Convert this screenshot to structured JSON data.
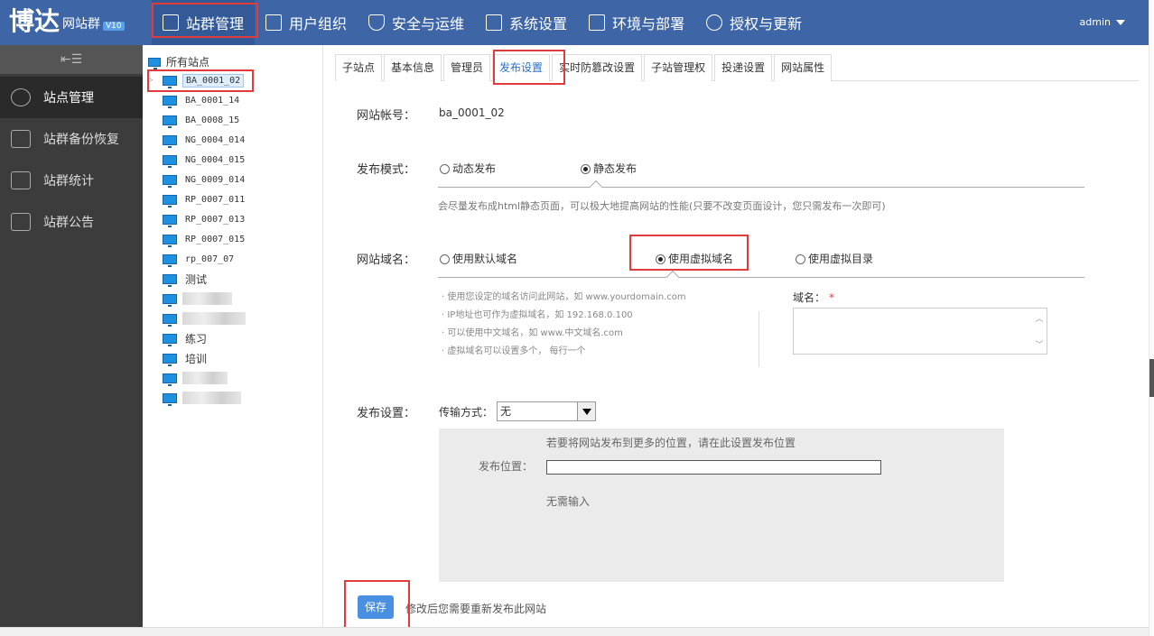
{
  "header": {
    "logo_main": "博达",
    "logo_sub": "网站群",
    "logo_version": "V10",
    "nav": [
      {
        "label": "站群管理",
        "icon": "site-manage-icon"
      },
      {
        "label": "用户组织",
        "icon": "user-org-icon"
      },
      {
        "label": "安全与运维",
        "icon": "shield-icon"
      },
      {
        "label": "系统设置",
        "icon": "settings-icon"
      },
      {
        "label": "环境与部署",
        "icon": "deploy-icon"
      },
      {
        "label": "授权与更新",
        "icon": "license-icon"
      }
    ],
    "user": "admin"
  },
  "sidebar": {
    "toggle": "⇤☰",
    "items": [
      {
        "label": "站点管理",
        "icon": "gear-icon"
      },
      {
        "label": "站群备份恢复",
        "icon": "backup-icon"
      },
      {
        "label": "站群统计",
        "icon": "chart-icon"
      },
      {
        "label": "站群公告",
        "icon": "announcement-icon"
      }
    ]
  },
  "tree": {
    "root": "所有站点",
    "nodes": [
      "BA_0001_02",
      "BA_0001_14",
      "BA_0008_15",
      "NG_0004_014",
      "NG_0004_015",
      "NG_0009_014",
      "RP_0007_011",
      "RP_0007_013",
      "RP_0007_015",
      "rp_007_07",
      "测试",
      "",
      "",
      "练习",
      "培训",
      "",
      ""
    ]
  },
  "tabs": [
    "子站点",
    "基本信息",
    "管理员",
    "发布设置",
    "实时防篡改设置",
    "子站管理权",
    "投递设置",
    "网站属性"
  ],
  "form": {
    "account_label": "网站帐号：",
    "account_value": "ba_0001_02",
    "mode_label": "发布模式：",
    "mode_dynamic": "动态发布",
    "mode_static": "静态发布",
    "mode_hint": "会尽量发布成html静态页面，可以极大地提高网站的性能(只要不改变页面设计，您只需发布一次即可)",
    "domain_label": "网站域名：",
    "domain_default": "使用默认域名",
    "domain_virtual": "使用虚拟域名",
    "domain_dir": "使用虚拟目录",
    "tips": [
      "·  使用您设定的域名访问此网站，如 www.yourdomain.com",
      "·  IP地址也可作为虚拟域名，如 192.168.0.100",
      "·  可以使用中文域名，如 www.中文域名.com",
      "·  虚拟域名可以设置多个， 每行一个"
    ],
    "domain_field_label": "域名：",
    "required_mark": "*",
    "publish_label": "发布设置：",
    "transfer_label": "传输方式：",
    "transfer_value": "无",
    "publish_hint": "若要将网站发布到更多的位置，请在此设置发布位置",
    "publish_loc_label": "发布位置：",
    "no_input": "无需输入",
    "save": "保存",
    "save_note": "修改后您需要重新发布此网站"
  }
}
